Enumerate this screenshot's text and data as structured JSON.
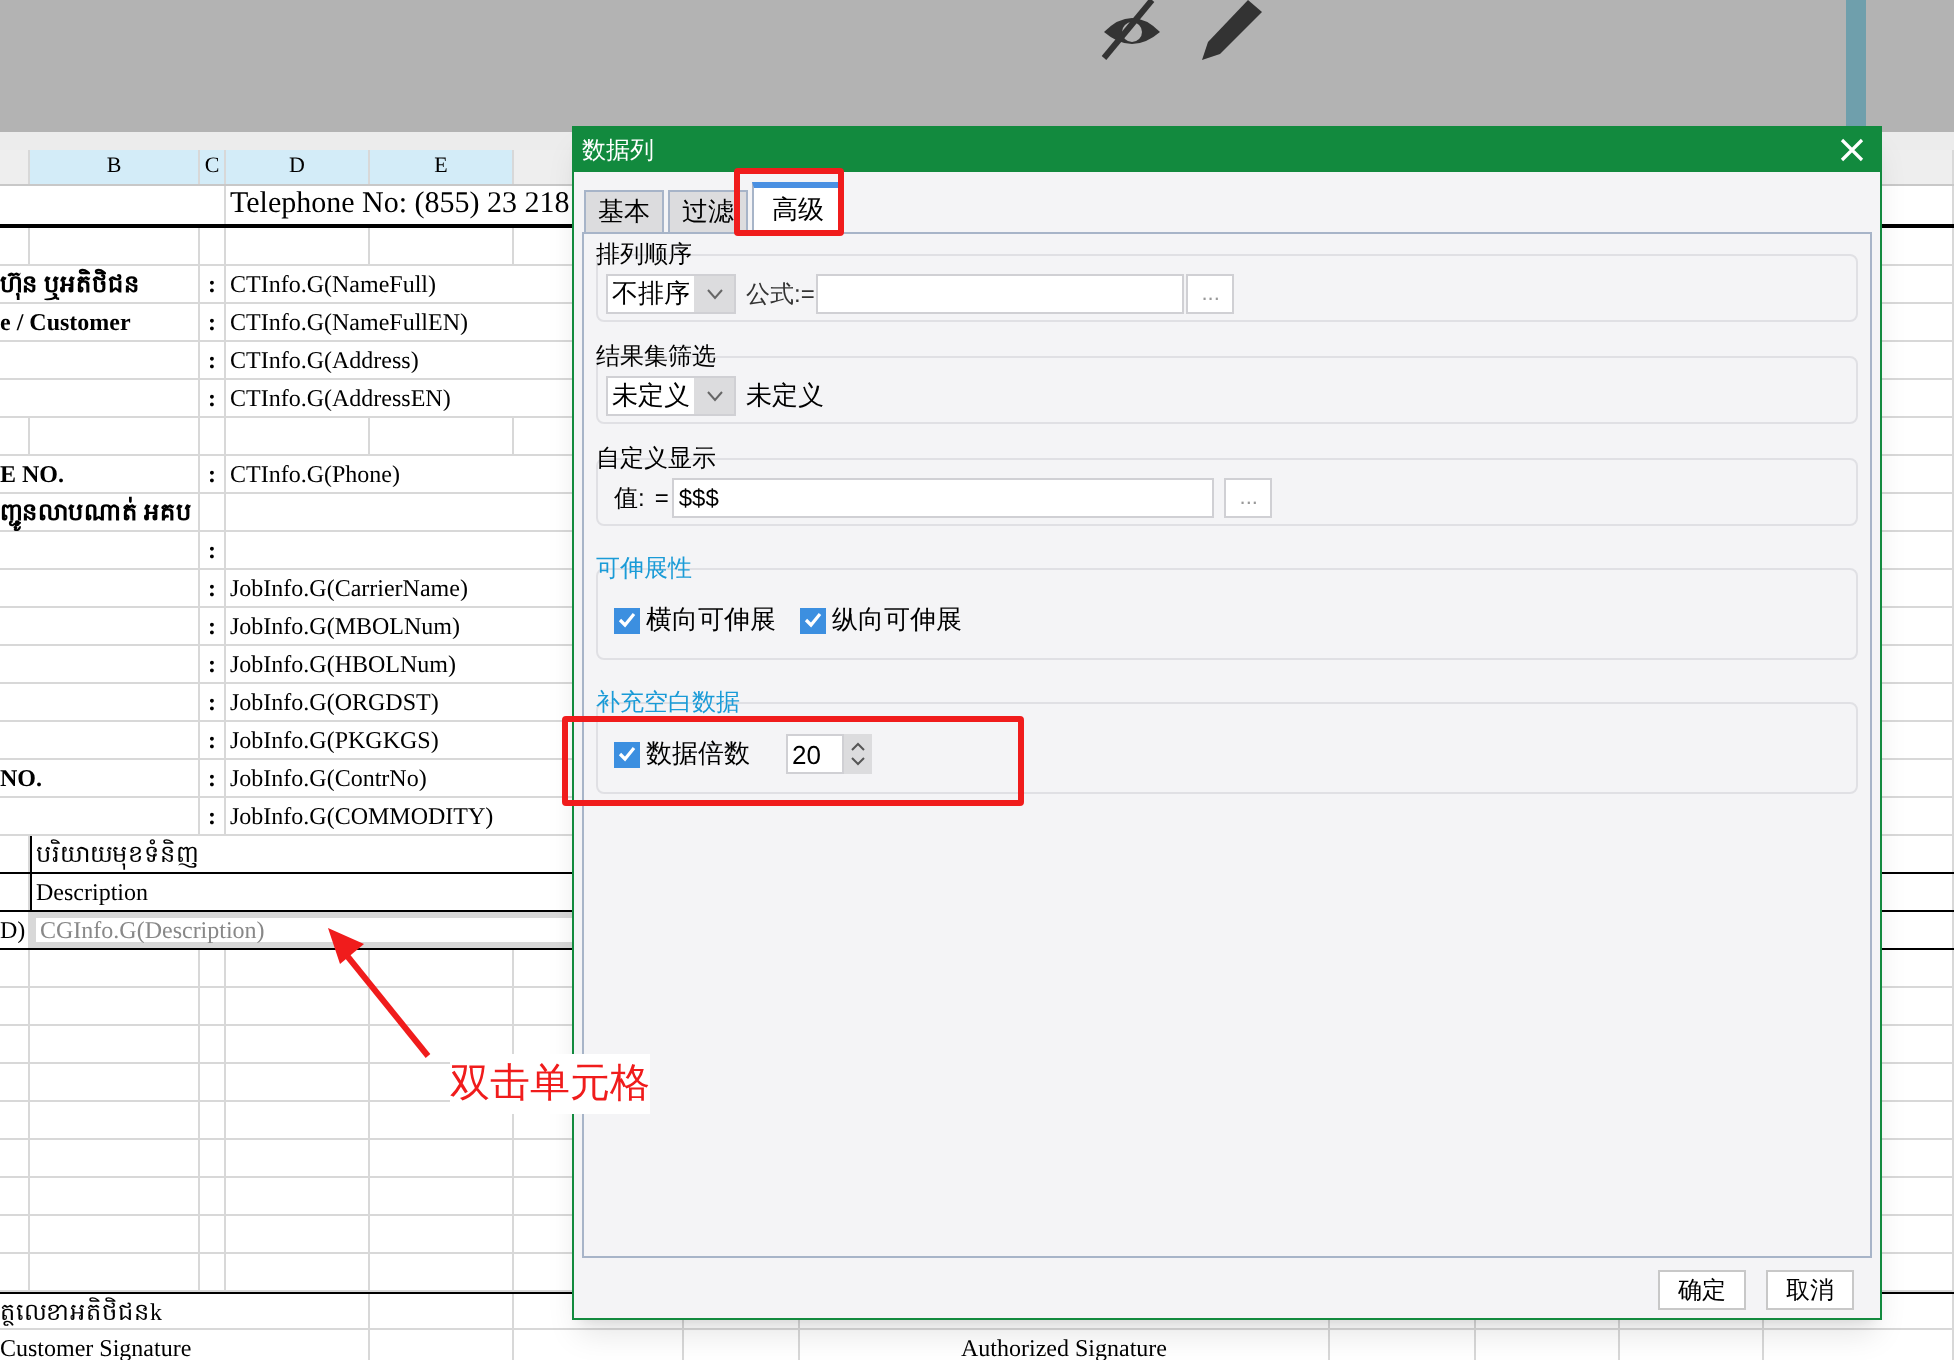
{
  "sheet": {
    "column_headers": [
      "B",
      "C",
      "D",
      "E"
    ],
    "rows": [
      {
        "kind": "title",
        "value": "Telephone No: (855) 23 218"
      },
      {
        "kind": "blank"
      },
      {
        "kind": "field",
        "label": "ហ៊ុន ឬអតិថិជន",
        "colon": ":",
        "value": "CTInfo.G(NameFull)"
      },
      {
        "kind": "field",
        "label": "e / Customer",
        "colon": ":",
        "value": "CTInfo.G(NameFullEN)"
      },
      {
        "kind": "field",
        "colon": ":",
        "value": "CTInfo.G(Address)"
      },
      {
        "kind": "field",
        "colon": ":",
        "value": "CTInfo.G(AddressEN)"
      },
      {
        "kind": "blank"
      },
      {
        "kind": "field",
        "label": "E NO.",
        "colon": ":",
        "value": "CTInfo.G(Phone)"
      },
      {
        "kind": "field",
        "label": "ញ្ជូនលាបណាត់ អគប"
      },
      {
        "kind": "field",
        "colon": ":"
      },
      {
        "kind": "field",
        "colon": ":",
        "value": "JobInfo.G(CarrierName)"
      },
      {
        "kind": "field",
        "colon": ":",
        "value": "JobInfo.G(MBOLNum)"
      },
      {
        "kind": "field",
        "colon": ":",
        "value": "JobInfo.G(HBOLNum)"
      },
      {
        "kind": "field",
        "colon": ":",
        "value": "JobInfo.G(ORGDST)"
      },
      {
        "kind": "field",
        "colon": ":",
        "value": "JobInfo.G(PKGKGS)"
      },
      {
        "kind": "field",
        "label": "NO.",
        "colon": ":",
        "value": "JobInfo.G(ContrNo)"
      },
      {
        "kind": "field",
        "colon": ":",
        "value": "JobInfo.G(COMMODITY)"
      },
      {
        "kind": "table",
        "value": "បរិយាយមុខទំនិញ",
        "selected": false
      },
      {
        "kind": "table",
        "value": "Description",
        "selected": false
      },
      {
        "kind": "table",
        "label": "D)",
        "value": "CGInfo.G(Description)",
        "selected": true
      },
      {
        "kind": "blank"
      },
      {
        "kind": "blank"
      },
      {
        "kind": "blank"
      },
      {
        "kind": "blank"
      },
      {
        "kind": "blank"
      },
      {
        "kind": "blank"
      },
      {
        "kind": "blank"
      },
      {
        "kind": "blank"
      },
      {
        "kind": "blank"
      },
      {
        "kind": "signature",
        "label": "ត្ថលេខាអតិថិជនk"
      },
      {
        "kind": "signature",
        "label": "Customer Signature",
        "value": "Authorized Signature"
      }
    ]
  },
  "dialog": {
    "title": "数据列",
    "tabs": [
      {
        "label": "基本",
        "selected": false
      },
      {
        "label": "过滤",
        "selected": false
      },
      {
        "label": "高级",
        "selected": true
      }
    ],
    "groups": [
      {
        "kind": "sort",
        "title": "排列顺序",
        "dropdown": "不排序",
        "label": "公式:=",
        "button": "..."
      },
      {
        "kind": "filter",
        "title": "结果集筛选",
        "dropdown": "未定义",
        "text": "未定义"
      },
      {
        "kind": "custom",
        "title": "自定义显示",
        "label": "值:",
        "equals": "=",
        "field_value": "$$$",
        "button": "..."
      },
      {
        "kind": "checks",
        "title": "可伸展性",
        "checkboxes": [
          {
            "label": "横向可伸展",
            "checked": true
          },
          {
            "label": "纵向可伸展",
            "checked": true
          }
        ]
      },
      {
        "kind": "fill",
        "title": "补充空白数据",
        "checkboxes": [
          {
            "label": "数据倍数",
            "checked": true
          }
        ],
        "spin_value": "20"
      }
    ],
    "buttons": [
      "确定",
      "取消"
    ]
  },
  "annotation": {
    "text": "双击单元格"
  }
}
